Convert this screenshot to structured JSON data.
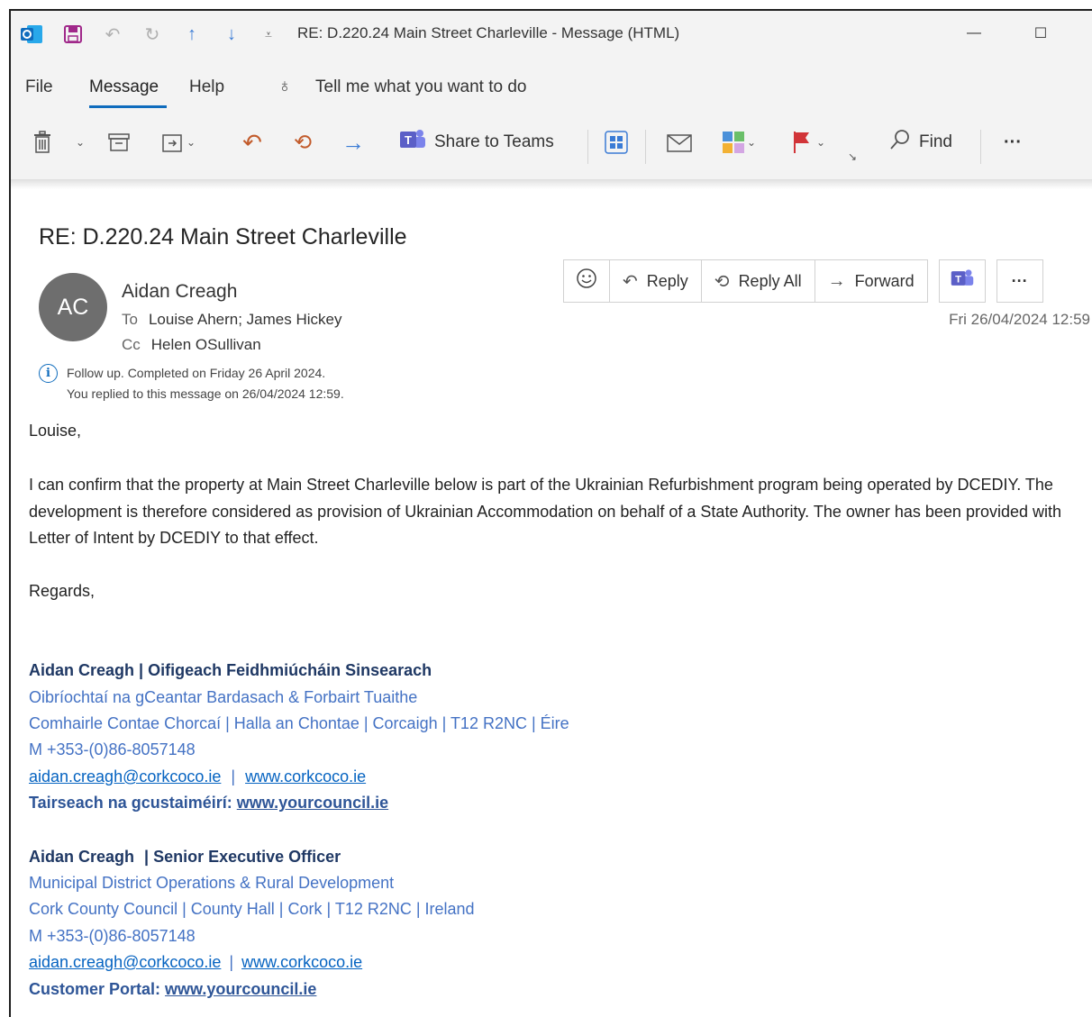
{
  "window": {
    "title": "RE: D.220.24 Main Street Charleville  -  Message (HTML)",
    "minimize": "—",
    "maximize": "☐"
  },
  "menu": {
    "file": "File",
    "message": "Message",
    "help": "Help",
    "tell_me": "Tell me what you want to do"
  },
  "ribbon": {
    "share_to_teams": "Share to Teams",
    "find": "Find",
    "more": "···"
  },
  "email": {
    "subject": "RE: D.220.24 Main Street Charleville",
    "avatar_initials": "AC",
    "sender": "Aidan Creagh",
    "to_label": "To",
    "to": "Louise Ahern; James Hickey",
    "cc_label": "Cc",
    "cc": "Helen OSullivan",
    "date": "Fri 26/04/2024 12:59",
    "follow_up": "Follow up.  Completed on Friday 26 April 2024.",
    "replied_note": "You replied to this message on 26/04/2024 12:59.",
    "actions": {
      "reply": "Reply",
      "reply_all": "Reply All",
      "forward": "Forward",
      "more": "···"
    },
    "greeting": "Louise,",
    "paragraph": "I can confirm that the property at Main Street Charleville below is part of the Ukrainian Refurbishment program being operated by DCEDIY. The development is therefore considered as provision of Ukrainian Accommodation on behalf of a State Authority. The owner has been provided with  Letter of Intent by DCEDIY to that effect.",
    "closing": "Regards,"
  },
  "signature_irish": {
    "name": "Aidan Creagh",
    "sep": " | ",
    "role": "Oifigeach Feidhmiúcháin Sinsearach",
    "dept": "Oibríochtaí na gCeantar Bardasach & Forbairt Tuaithe",
    "address": "Comhairle Contae Chorcaí | Halla an Chontae | Corcaigh | T12 R2NC | Éire",
    "mobile": "M +353-(0)86-8057148",
    "email": "aidan.creagh@corkcoco.ie",
    "divider": " | ",
    "web": "www.corkcoco.ie",
    "portal_label": "Tairseach na gcustaiméirí: ",
    "portal": "www.yourcouncil.ie"
  },
  "signature_english": {
    "name": "Aidan Creagh",
    "sep": " | ",
    "role": "Senior Executive Officer",
    "dept": "Municipal District Operations & Rural Development",
    "address": "Cork County Council | County Hall | Cork | T12 R2NC | Ireland",
    "mobile": "M +353-(0)86-8057148",
    "email": "aidan.creagh@corkcoco.ie",
    "divider": " | ",
    "web": "www.corkcoco.ie",
    "portal_label": "Customer Portal: ",
    "portal": "www.yourcouncil.ie"
  },
  "icons": [
    "outlook-icon",
    "save-icon",
    "undo-icon",
    "redo-icon",
    "up-arrow-icon",
    "down-arrow-icon",
    "customize-icon",
    "lightbulb-icon",
    "delete-icon",
    "archive-icon",
    "move-icon",
    "reply-icon",
    "reply-all-icon",
    "forward-icon",
    "teams-icon",
    "apps-icon",
    "mark-unread-icon",
    "categorize-icon",
    "flag-icon",
    "search-icon",
    "emoji-icon",
    "info-icon"
  ],
  "colors": {
    "accent": "#0f6cbd",
    "signature_name": "#1f3864",
    "signature_text": "#4472c4",
    "link": "#0563c1",
    "avatar_bg": "#6e6e6e",
    "flag": "#d13438",
    "teams": "#5b5fc7"
  }
}
